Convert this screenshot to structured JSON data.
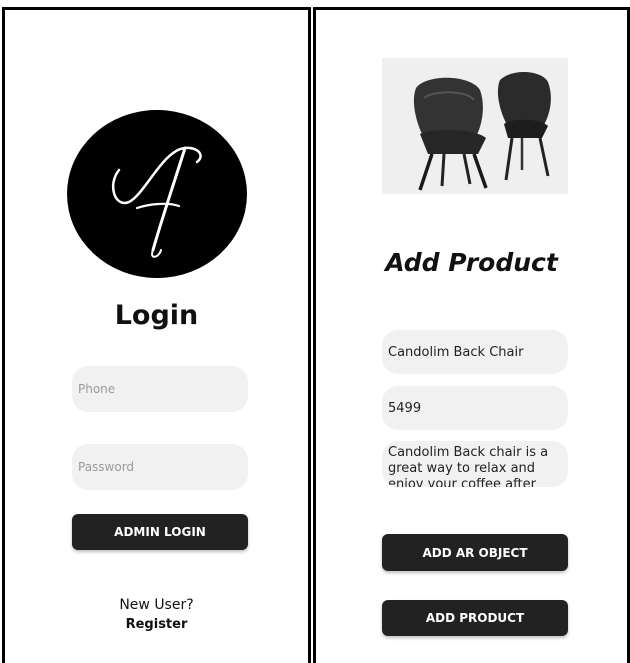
{
  "login": {
    "title": "Login",
    "logo_icon": "script-f-logo-icon",
    "phone_placeholder": "Phone",
    "password_placeholder": "Password",
    "admin_login_label": "ADMIN LOGIN",
    "new_user_text": "New User?",
    "register_label": "Register"
  },
  "add_product": {
    "image_icon": "chairs-image",
    "title": "Add Product",
    "name_value": "Candolim Back Chair",
    "price_value": "5499",
    "description_value": "Candolim Back chair is a great way to relax and enjoy your coffee after",
    "add_ar_object_label": "ADD AR OBJECT",
    "add_product_label": "ADD PRODUCT"
  },
  "colors": {
    "button_bg": "#222222",
    "field_bg": "#f1f1f1",
    "cursor": "#2bb6b0"
  }
}
